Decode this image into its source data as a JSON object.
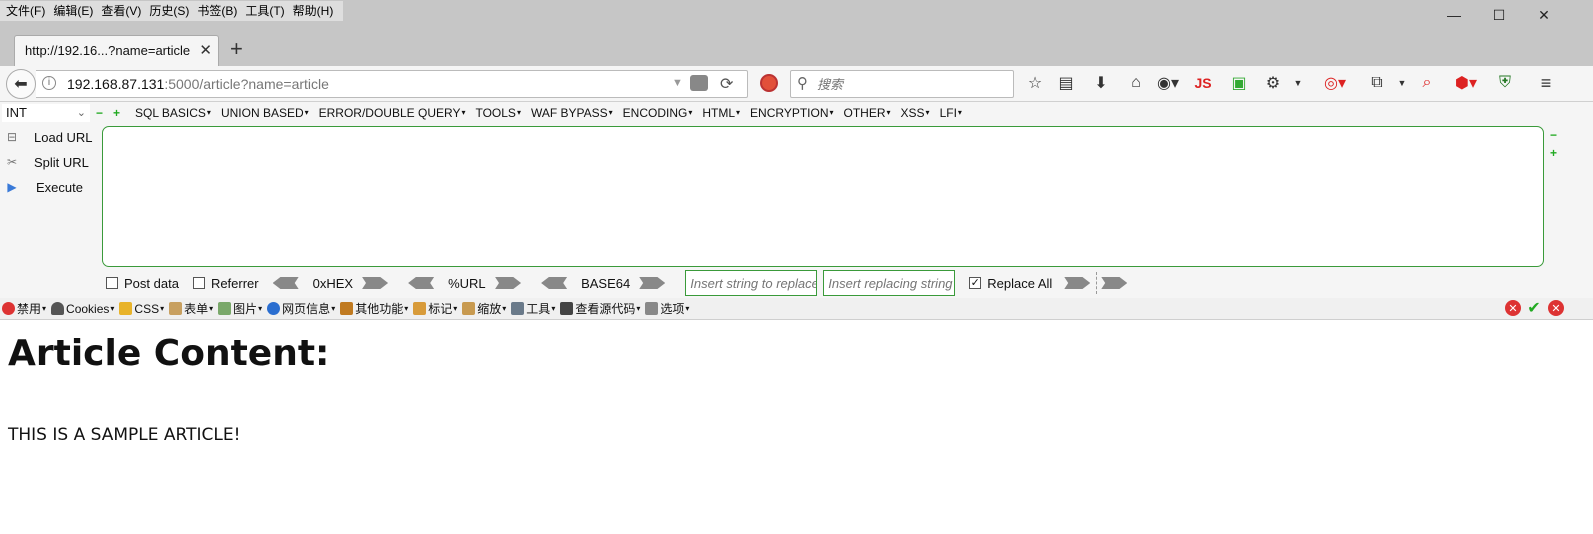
{
  "menubar": {
    "items": [
      "文件(F)",
      "编辑(E)",
      "查看(V)",
      "历史(S)",
      "书签(B)",
      "工具(T)",
      "帮助(H)"
    ]
  },
  "window_controls": {
    "minimize": "—",
    "maximize": "☐",
    "close": "✕"
  },
  "tab": {
    "title": "http://192.16...?name=article",
    "close": "✕"
  },
  "new_tab": "+",
  "nav": {
    "back_icon": "arrow-left",
    "url_host": "192.168.87.131",
    "url_rest": ":5000/article?name=article",
    "search_placeholder": "搜索",
    "js_label": "JS"
  },
  "hackbar": {
    "select_value": "INT",
    "menus": [
      "SQL BASICS",
      "UNION BASED",
      "ERROR/DOUBLE QUERY",
      "TOOLS",
      "WAF BYPASS",
      "ENCODING",
      "HTML",
      "ENCRYPTION",
      "OTHER",
      "XSS",
      "LFI"
    ],
    "load_url": "Load URL",
    "split_url": "Split URL",
    "execute": "Execute",
    "post_data": "Post data",
    "referrer": "Referrer",
    "hex": "0xHEX",
    "url_enc": "%URL",
    "base64": "BASE64",
    "insert_placeholder": "Insert string to replace",
    "replacing_placeholder": "Insert replacing string",
    "replace_all": "Replace All",
    "replace_all_checked": true
  },
  "addons": {
    "items": [
      "禁用",
      "Cookies",
      "CSS",
      "表单",
      "图片",
      "网页信息",
      "其他功能",
      "标记",
      "缩放",
      "工具",
      "查看源代码",
      "选项"
    ]
  },
  "content": {
    "heading": "Article Content:",
    "body": "THIS IS A SAMPLE ARTICLE!"
  }
}
